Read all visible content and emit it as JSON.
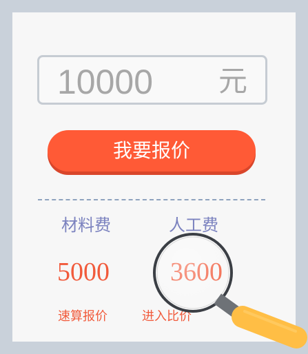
{
  "quote": {
    "amount": "10000",
    "unit": "元",
    "button_label": "我要报价"
  },
  "breakdown": {
    "material_label": "材料费",
    "labor_label": "人工费",
    "material_value": "5000",
    "labor_value": "3600"
  },
  "links": {
    "quick_quote": "速算报价",
    "compare_price": "进入比价"
  },
  "colors": {
    "accent": "#ff5a36",
    "price": "#f15a3b",
    "label": "#7b82bf",
    "border": "#c6ccd3"
  },
  "icons": {
    "magnifier": "magnifying-glass-icon"
  }
}
